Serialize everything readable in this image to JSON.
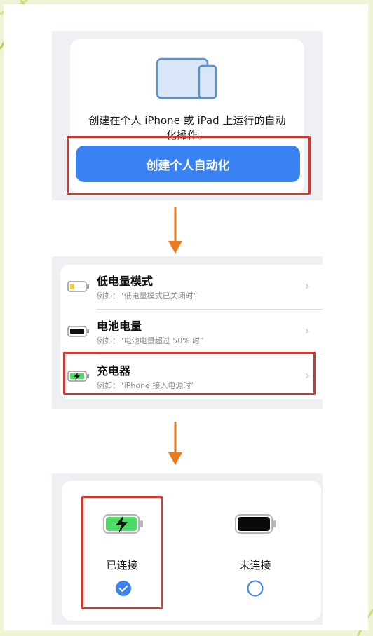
{
  "panel1": {
    "description_line1": "创建在个人 iPhone 或 iPad 上运行的自动",
    "description_line2": "化操作。",
    "button_label": "创建个人自动化"
  },
  "panel2": {
    "rows": [
      {
        "title": "低电量模式",
        "subtitle": "例如：“低电量模式已关闭时”",
        "icon": "low-battery-icon"
      },
      {
        "title": "电池电量",
        "subtitle": "例如：“电池电量超过 50% 时”",
        "icon": "battery-icon"
      },
      {
        "title": "充电器",
        "subtitle": "例如：“iPhone 接入电源时”",
        "icon": "charging-battery-icon"
      }
    ]
  },
  "panel3": {
    "options": [
      {
        "label": "已连接",
        "selected": true,
        "icon": "charging-battery-icon"
      },
      {
        "label": "未连接",
        "selected": false,
        "icon": "battery-full-black-icon"
      }
    ]
  },
  "colors": {
    "accent_blue": "#3a82f2",
    "highlight_red": "#cf3b33",
    "arrow_orange": "#ec7a1e",
    "charge_green": "#4cd964"
  }
}
